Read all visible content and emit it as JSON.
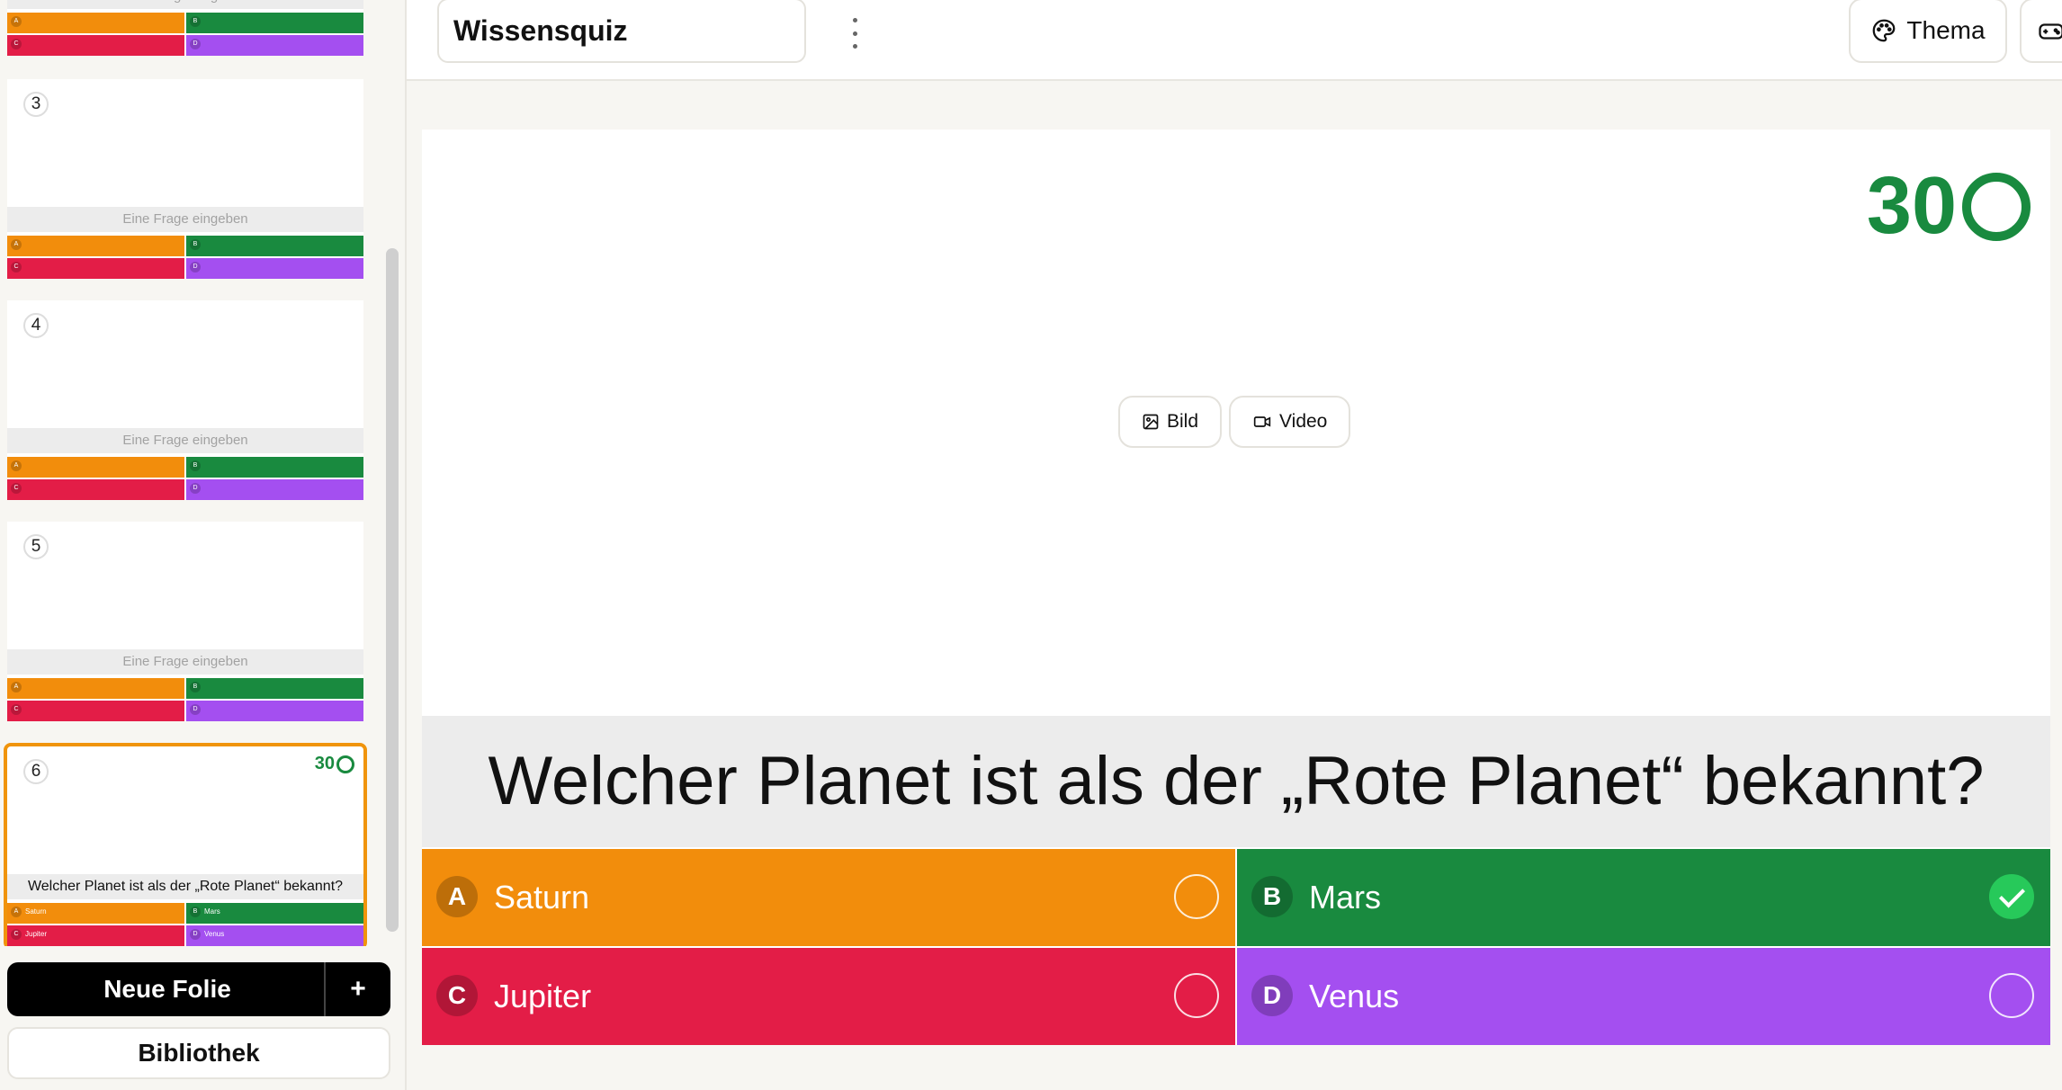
{
  "app": {
    "title": "Wissensquiz"
  },
  "topbar": {
    "thema_label": "Thema"
  },
  "sidebar": {
    "slides": [
      {
        "number": "",
        "question": "Eine Frage eingeben",
        "answers": [
          "A",
          "B",
          "C",
          "D"
        ],
        "texts": [
          "",
          "",
          "",
          ""
        ]
      },
      {
        "number": "3",
        "question": "Eine Frage eingeben",
        "answers": [
          "A",
          "B",
          "C",
          "D"
        ],
        "texts": [
          "",
          "",
          "",
          ""
        ]
      },
      {
        "number": "4",
        "question": "Eine Frage eingeben",
        "answers": [
          "A",
          "B",
          "C",
          "D"
        ],
        "texts": [
          "",
          "",
          "",
          ""
        ]
      },
      {
        "number": "5",
        "question": "Eine Frage eingeben",
        "answers": [
          "A",
          "B",
          "C",
          "D"
        ],
        "texts": [
          "",
          "",
          "",
          ""
        ]
      },
      {
        "number": "6",
        "question": "Welcher Planet ist als der „Rote Planet“ bekannt?",
        "timer": "30",
        "answers": [
          "A",
          "B",
          "C",
          "D"
        ],
        "texts": [
          "Saturn",
          "Mars",
          "Jupiter",
          "Venus"
        ]
      }
    ],
    "new_slide_label": "Neue Folie",
    "add_label": "+",
    "library_label": "Bibliothek"
  },
  "slide": {
    "timer": "30",
    "media": {
      "image_label": "Bild",
      "video_label": "Video"
    },
    "question": "Welcher Planet ist als der „Rote Planet“ bekannt?",
    "answers": [
      {
        "letter": "A",
        "text": "Saturn",
        "color": "#f28d0c",
        "correct": false
      },
      {
        "letter": "B",
        "text": "Mars",
        "color": "#198a3f",
        "correct": true
      },
      {
        "letter": "C",
        "text": "Jupiter",
        "color": "#e31d47",
        "correct": false
      },
      {
        "letter": "D",
        "text": "Venus",
        "color": "#a44ff0",
        "correct": false
      }
    ]
  },
  "colors": {
    "accent": "#f0940c",
    "timer": "#198a3f"
  },
  "icons": {
    "kebab": "more-vertical-icon",
    "thema": "palette-icon",
    "extra": "gamepad-icon",
    "image": "image-icon",
    "video": "video-icon"
  }
}
